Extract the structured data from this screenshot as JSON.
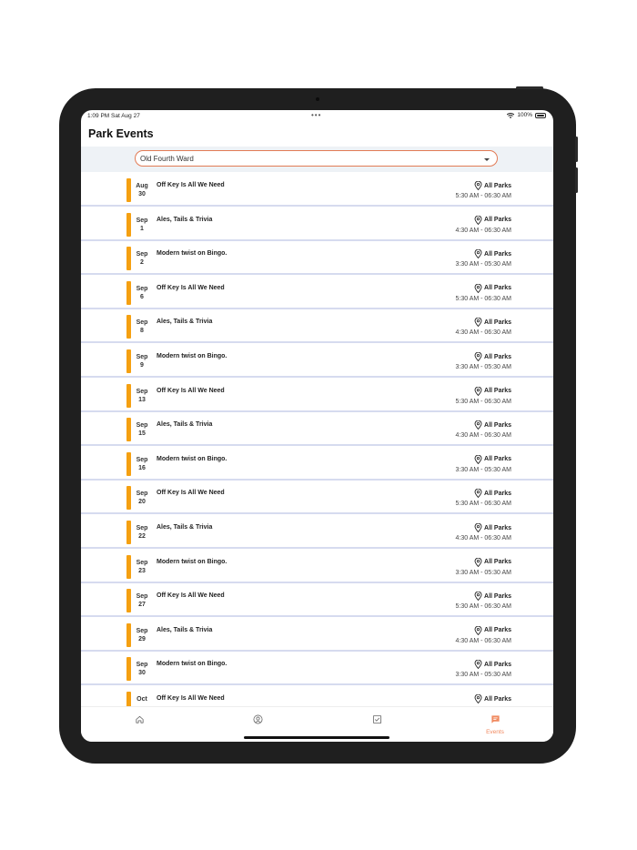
{
  "status_bar": {
    "time": "1:09 PM  Sat Aug 27",
    "dots": "•••",
    "battery": "100%"
  },
  "page": {
    "title": "Park Events"
  },
  "filter": {
    "selected": "Old Fourth Ward"
  },
  "colors": {
    "accent": "#f08a60",
    "event_bar": "#f5a011"
  },
  "events": [
    {
      "month": "Aug",
      "day": "30",
      "title": "Off Key Is All We Need",
      "location": "All Parks",
      "time": "5:30 AM - 06:30 AM"
    },
    {
      "month": "Sep",
      "day": "1",
      "title": "Ales, Tails & Trivia",
      "location": "All Parks",
      "time": "4:30 AM - 06:30 AM"
    },
    {
      "month": "Sep",
      "day": "2",
      "title": "Modern twist on Bingo.",
      "location": "All Parks",
      "time": "3:30 AM - 05:30 AM"
    },
    {
      "month": "Sep",
      "day": "6",
      "title": "Off Key Is All We Need",
      "location": "All Parks",
      "time": "5:30 AM - 06:30 AM"
    },
    {
      "month": "Sep",
      "day": "8",
      "title": "Ales, Tails & Trivia",
      "location": "All Parks",
      "time": "4:30 AM - 06:30 AM"
    },
    {
      "month": "Sep",
      "day": "9",
      "title": "Modern twist on Bingo.",
      "location": "All Parks",
      "time": "3:30 AM - 05:30 AM"
    },
    {
      "month": "Sep",
      "day": "13",
      "title": "Off Key Is All We Need",
      "location": "All Parks",
      "time": "5:30 AM - 06:30 AM"
    },
    {
      "month": "Sep",
      "day": "15",
      "title": "Ales, Tails & Trivia",
      "location": "All Parks",
      "time": "4:30 AM - 06:30 AM"
    },
    {
      "month": "Sep",
      "day": "16",
      "title": "Modern twist on Bingo.",
      "location": "All Parks",
      "time": "3:30 AM - 05:30 AM"
    },
    {
      "month": "Sep",
      "day": "20",
      "title": "Off Key Is All We Need",
      "location": "All Parks",
      "time": "5:30 AM - 06:30 AM"
    },
    {
      "month": "Sep",
      "day": "22",
      "title": "Ales, Tails & Trivia",
      "location": "All Parks",
      "time": "4:30 AM - 06:30 AM"
    },
    {
      "month": "Sep",
      "day": "23",
      "title": "Modern twist on Bingo.",
      "location": "All Parks",
      "time": "3:30 AM - 05:30 AM"
    },
    {
      "month": "Sep",
      "day": "27",
      "title": "Off Key Is All We Need",
      "location": "All Parks",
      "time": "5:30 AM - 06:30 AM"
    },
    {
      "month": "Sep",
      "day": "29",
      "title": "Ales, Tails & Trivia",
      "location": "All Parks",
      "time": "4:30 AM - 06:30 AM"
    },
    {
      "month": "Sep",
      "day": "30",
      "title": "Modern twist on Bingo.",
      "location": "All Parks",
      "time": "3:30 AM - 05:30 AM"
    },
    {
      "month": "Oct",
      "day": "",
      "title": "Off Key Is All We Need",
      "location": "All Parks",
      "time": ""
    }
  ],
  "tabs": [
    {
      "icon": "home-icon",
      "label": ""
    },
    {
      "icon": "profile-icon",
      "label": ""
    },
    {
      "icon": "checklist-icon",
      "label": ""
    },
    {
      "icon": "chat-icon",
      "label": "Events"
    }
  ]
}
